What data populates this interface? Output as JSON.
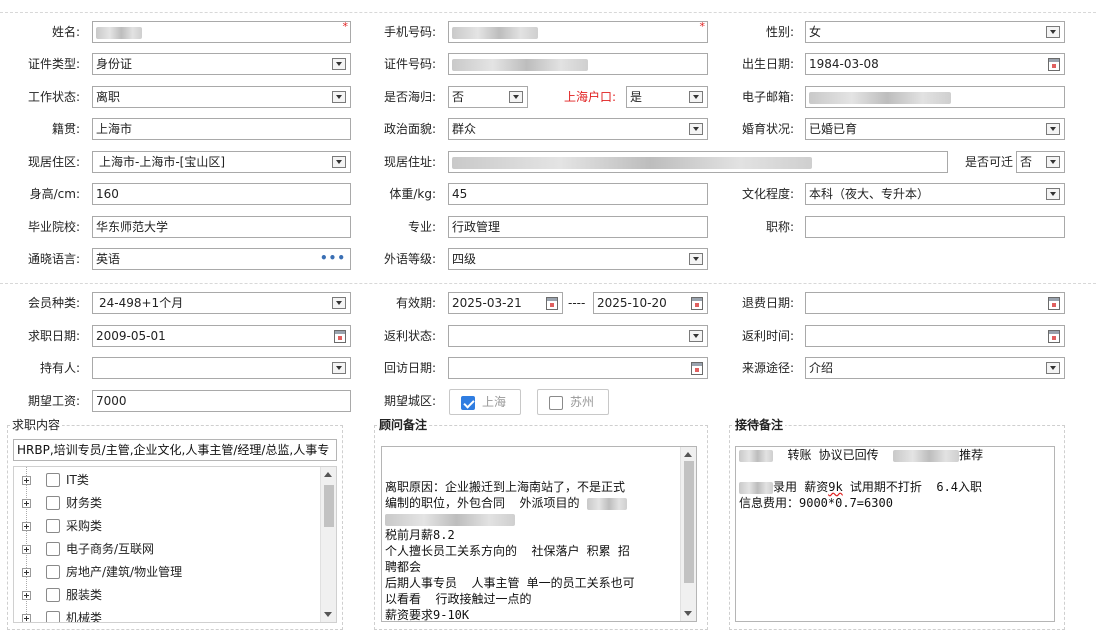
{
  "basic": {
    "name": {
      "label": "姓名:"
    },
    "phone": {
      "label": "手机号码:"
    },
    "gender": {
      "label": "性别:",
      "value": "女"
    },
    "id_type": {
      "label": "证件类型:",
      "value": "身份证"
    },
    "id_no": {
      "label": "证件号码:"
    },
    "birth": {
      "label": "出生日期:",
      "value": "1984-03-08"
    },
    "work_status": {
      "label": "工作状态:",
      "value": "离职"
    },
    "returnee": {
      "label": "是否海归:",
      "value": "否"
    },
    "hukou": {
      "label": "上海户口:",
      "value": "是"
    },
    "email": {
      "label": "电子邮箱:"
    },
    "native": {
      "label": "籍贯:",
      "value": "上海市"
    },
    "political": {
      "label": "政治面貌:",
      "value": "群众"
    },
    "marital": {
      "label": "婚育状况:",
      "value": "已婚已育"
    },
    "residence": {
      "label": "现居住区:",
      "value": "上海市-上海市-[宝山区]"
    },
    "address": {
      "label": "现居住址:"
    },
    "relocate": {
      "label": "是否可迁",
      "value": "否"
    },
    "height": {
      "label": "身高/cm:",
      "value": "160"
    },
    "weight": {
      "label": "体重/kg:",
      "value": "45"
    },
    "education": {
      "label": "文化程度:",
      "value": "本科（夜大、专升本）"
    },
    "school": {
      "label": "毕业院校:",
      "value": "华东师范大学"
    },
    "major": {
      "label": "专业:",
      "value": "行政管理"
    },
    "title": {
      "label": "职称:",
      "value": ""
    },
    "language": {
      "label": "通晓语言:",
      "value": "英语"
    },
    "lang_level": {
      "label": "外语等级:",
      "value": "四级"
    }
  },
  "member": {
    "type": {
      "label": "会员种类:",
      "value": "24-498+1个月"
    },
    "valid": {
      "label": "有效期:",
      "from": "2025-03-21",
      "sep": "----",
      "to": "2025-10-20"
    },
    "refund_date": {
      "label": "退费日期:",
      "value": ""
    },
    "job_date": {
      "label": "求职日期:",
      "value": "2009-05-01"
    },
    "rebate_status": {
      "label": "返利状态:",
      "value": ""
    },
    "rebate_time": {
      "label": "返利时间:",
      "value": ""
    },
    "holder": {
      "label": "持有人:",
      "value": ""
    },
    "visit_date": {
      "label": "回访日期:",
      "value": ""
    },
    "source": {
      "label": "来源途径:",
      "value": "介绍"
    },
    "salary": {
      "label": "期望工资:",
      "value": "7000"
    },
    "city": {
      "label": "期望城区:",
      "options": [
        "上海",
        "苏州"
      ]
    }
  },
  "job_content": {
    "title": "求职内容",
    "selected": "HRBP,培训专员/主管,企业文化,人事主管/经理/总监,人事专",
    "tree": [
      "IT类",
      "财务类",
      "采购类",
      "电子商务/互联网",
      "房地产/建筑/物业管理",
      "服装类",
      "机械类"
    ]
  },
  "advisor": {
    "title": "顾问备注",
    "lines": [
      "",
      "",
      "离职原因：企业搬迁到上海南站了，不是正式",
      "编制的职位，外包合同  外派项目的",
      "",
      "税前月薪8.2",
      "个人擅长员工关系方向的  社保落户 积累 招",
      "聘都会",
      "后期人事专员  人事主管 单一的员工关系也可",
      "以看看  行政接触过一点的",
      "薪资要求9-10K"
    ]
  },
  "reception": {
    "title": "接待备注",
    "line1_a": "转账 协议已回传",
    "line1_b": "推荐",
    "line3_a": "录用 薪资",
    "line3_b": "9k",
    "line3_c": " 试用期不打折  6.4入职",
    "line4": "信息费用：9000*0.7=6300"
  }
}
